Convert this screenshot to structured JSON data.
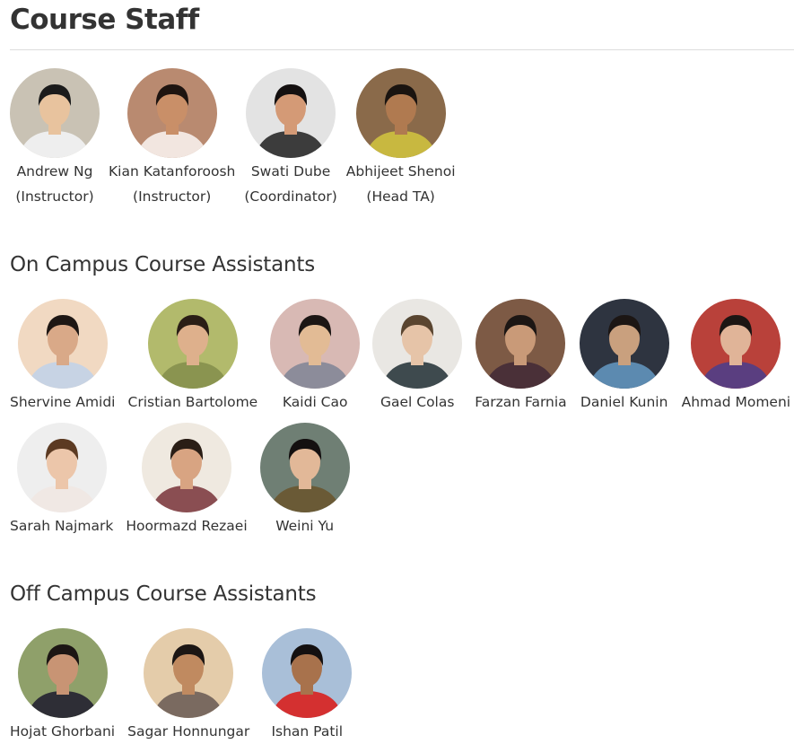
{
  "page": {
    "title": "Course Staff"
  },
  "staff": [
    {
      "name": "Andrew Ng",
      "role": "(Instructor)",
      "bg": "#c9c2b4",
      "skin": "#e8c39e",
      "hair": "#1b1b1b",
      "shirt": "#eeeeee"
    },
    {
      "name": "Kian Katanforoosh",
      "role": "(Instructor)",
      "bg": "#b98a70",
      "skin": "#c98f68",
      "hair": "#1e1410",
      "shirt": "#f2e6e0"
    },
    {
      "name": "Swati Dube",
      "role": "(Coordinator)",
      "bg": "#e3e3e3",
      "skin": "#d49a76",
      "hair": "#141010",
      "shirt": "#3c3c3c"
    },
    {
      "name": "Abhijeet Shenoi",
      "role": "(Head TA)",
      "bg": "#8a6a4a",
      "skin": "#b07a50",
      "hair": "#1a1410",
      "shirt": "#c8b840"
    }
  ],
  "on_campus": {
    "title": "On Campus Course Assistants",
    "row1": [
      {
        "name": "Shervine Amidi",
        "bg": "#f1d9c2",
        "skin": "#d9a988",
        "hair": "#1e1714",
        "shirt": "#c7d3e4"
      },
      {
        "name": "Cristian Bartolome",
        "bg": "#b2ba6c",
        "skin": "#deb08c",
        "hair": "#2a1e16",
        "shirt": "#8a9450"
      },
      {
        "name": "Kaidi Cao",
        "bg": "#d8b9b4",
        "skin": "#e2bb95",
        "hair": "#1c1614",
        "shirt": "#8c8c9a"
      },
      {
        "name": "Gael Colas",
        "bg": "#e9e7e3",
        "skin": "#e6c4a8",
        "hair": "#5a4530",
        "shirt": "#3e4a4e"
      },
      {
        "name": "Farzan Farnia",
        "bg": "#7d5a45",
        "skin": "#c99a78",
        "hair": "#1c1614",
        "shirt": "#4a3038"
      },
      {
        "name": "Daniel Kunin",
        "bg": "#2e3440",
        "skin": "#c9a07e",
        "hair": "#1c1614",
        "shirt": "#5c8ab0"
      },
      {
        "name": "Ahmad Momeni",
        "bg": "#b9413a",
        "skin": "#e0b498",
        "hair": "#1c1614",
        "shirt": "#5a3e80"
      }
    ],
    "row2": [
      {
        "name": "Sarah Najmark",
        "bg": "#eeeeee",
        "skin": "#ecc6aa",
        "hair": "#5c3a22",
        "shirt": "#f0e8e4"
      },
      {
        "name": "Hoormazd Rezaei",
        "bg": "#efe9e0",
        "skin": "#d8a482",
        "hair": "#2a1e16",
        "shirt": "#8a4e52"
      },
      {
        "name": "Weini Yu",
        "bg": "#6f7f74",
        "skin": "#e2b898",
        "hair": "#141010",
        "shirt": "#6a5a36"
      }
    ]
  },
  "off_campus": {
    "title": "Off Campus Course Assistants",
    "row1": [
      {
        "name": "Hojat Ghorbani",
        "bg": "#8fa06a",
        "skin": "#c89474",
        "hair": "#1c1614",
        "shirt": "#2e2e36"
      },
      {
        "name": "Sagar Honnungar",
        "bg": "#e4ccaa",
        "skin": "#c08a60",
        "hair": "#1c1614",
        "shirt": "#7a6a60"
      },
      {
        "name": "Ishan Patil",
        "bg": "#a9bfd8",
        "skin": "#a8724c",
        "hair": "#141010",
        "shirt": "#d43030"
      }
    ]
  }
}
